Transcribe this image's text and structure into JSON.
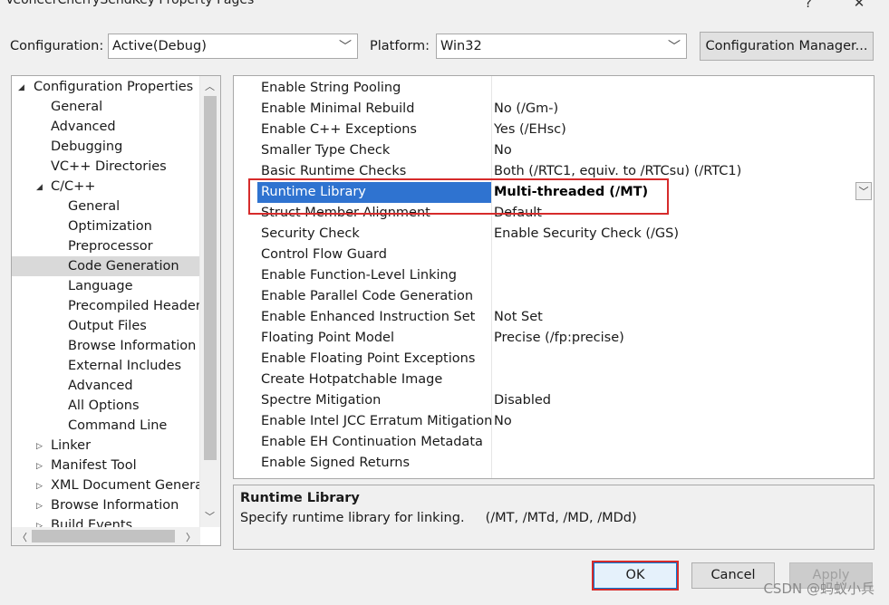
{
  "window": {
    "title": "VeoneerCherrySendKey Property Pages",
    "help_glyph": "?",
    "close_glyph": "✕"
  },
  "header": {
    "configuration_label": "Configuration:",
    "configuration_value": "Active(Debug)",
    "platform_label": "Platform:",
    "platform_value": "Win32",
    "config_manager_label": "Configuration Manager..."
  },
  "tree": {
    "items": [
      {
        "label": "Configuration Properties",
        "expander": "◢"
      },
      {
        "label": "General"
      },
      {
        "label": "Advanced"
      },
      {
        "label": "Debugging"
      },
      {
        "label": "VC++ Directories"
      },
      {
        "label": "C/C++",
        "expander": "◢"
      },
      {
        "label": "General"
      },
      {
        "label": "Optimization"
      },
      {
        "label": "Preprocessor"
      },
      {
        "label": "Code Generation",
        "selected": true
      },
      {
        "label": "Language"
      },
      {
        "label": "Precompiled Headers"
      },
      {
        "label": "Output Files"
      },
      {
        "label": "Browse Information"
      },
      {
        "label": "External Includes"
      },
      {
        "label": "Advanced"
      },
      {
        "label": "All Options"
      },
      {
        "label": "Command Line"
      },
      {
        "label": "Linker",
        "expander": "▷"
      },
      {
        "label": "Manifest Tool",
        "expander": "▷"
      },
      {
        "label": "XML Document Generato",
        "expander": "▷"
      },
      {
        "label": "Browse Information",
        "expander": "▷"
      },
      {
        "label": "Build Events",
        "expander": "▷"
      }
    ]
  },
  "grid": {
    "rows": [
      {
        "name": "Enable String Pooling",
        "value": ""
      },
      {
        "name": "Enable Minimal Rebuild",
        "value": "No (/Gm-)"
      },
      {
        "name": "Enable C++ Exceptions",
        "value": "Yes (/EHsc)"
      },
      {
        "name": "Smaller Type Check",
        "value": "No"
      },
      {
        "name": "Basic Runtime Checks",
        "value": "Both (/RTC1, equiv. to /RTCsu) (/RTC1)"
      },
      {
        "name": "Runtime Library",
        "value": "Multi-threaded (/MT)",
        "selected": true
      },
      {
        "name": "Struct Member Alignment",
        "value": "Default"
      },
      {
        "name": "Security Check",
        "value": "Enable Security Check (/GS)"
      },
      {
        "name": "Control Flow Guard",
        "value": ""
      },
      {
        "name": "Enable Function-Level Linking",
        "value": ""
      },
      {
        "name": "Enable Parallel Code Generation",
        "value": ""
      },
      {
        "name": "Enable Enhanced Instruction Set",
        "value": "Not Set"
      },
      {
        "name": "Floating Point Model",
        "value": "Precise (/fp:precise)"
      },
      {
        "name": "Enable Floating Point Exceptions",
        "value": ""
      },
      {
        "name": "Create Hotpatchable Image",
        "value": ""
      },
      {
        "name": "Spectre Mitigation",
        "value": "Disabled"
      },
      {
        "name": "Enable Intel JCC Erratum Mitigation",
        "value": "No"
      },
      {
        "name": "Enable EH Continuation Metadata",
        "value": ""
      },
      {
        "name": "Enable Signed Returns",
        "value": ""
      }
    ],
    "dropdown_glyph": "﹀"
  },
  "description": {
    "title": "Runtime Library",
    "text": "Specify runtime library for linking.     (/MT, /MTd, /MD, /MDd)"
  },
  "buttons": {
    "ok": "OK",
    "cancel": "Cancel",
    "apply": "Apply"
  },
  "watermark": "CSDN @蚂蚁小兵",
  "colors": {
    "selection_blue": "#2f73d0",
    "highlight_red": "#d62b2b",
    "tree_selection": "#d9d9d9"
  }
}
